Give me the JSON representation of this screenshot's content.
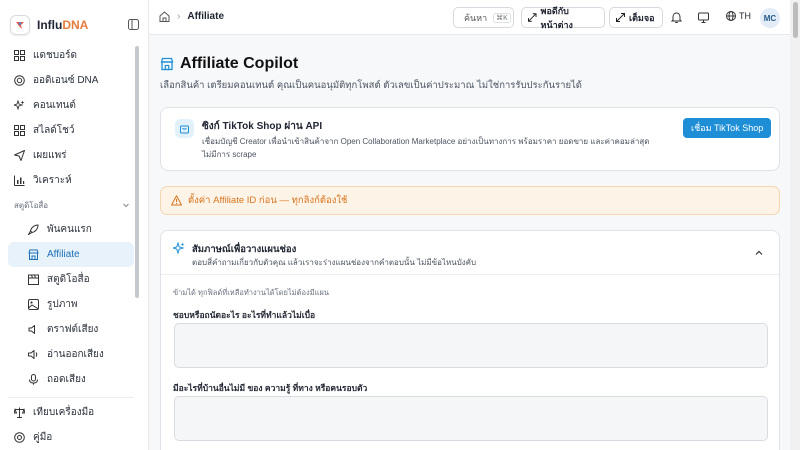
{
  "brand": {
    "prefix": "Influ",
    "suffix": "DNA"
  },
  "sidebar": {
    "items": [
      {
        "label": "แดชบอร์ด",
        "icon": "dashboard-icon"
      },
      {
        "label": "ออดิเอนซ์ DNA",
        "icon": "audience-icon"
      },
      {
        "label": "คอนเทนต์",
        "icon": "sparkle-icon"
      },
      {
        "label": "สไลด์โชว์",
        "icon": "grid-icon"
      },
      {
        "label": "เผยแพร่",
        "icon": "send-icon"
      },
      {
        "label": "วิเคราะห์",
        "icon": "chart-icon"
      }
    ],
    "section_label": "สตูดิโอสื่อ",
    "sub_items": [
      {
        "label": "พันคนแรก",
        "icon": "rocket-icon"
      },
      {
        "label": "Affiliate",
        "icon": "store-icon",
        "active": true
      },
      {
        "label": "สตูดิโอสื่อ",
        "icon": "clapper-icon"
      },
      {
        "label": "รูปภาพ",
        "icon": "image-icon"
      },
      {
        "label": "ตราฟต์เสียง",
        "icon": "speaker-icon"
      },
      {
        "label": "อ่านออกเสียง",
        "icon": "volume-icon"
      },
      {
        "label": "ถอดเสียง",
        "icon": "mic-icon"
      }
    ],
    "bottom_items": [
      {
        "label": "เทียบเครื่องมือ",
        "icon": "scale-icon"
      },
      {
        "label": "คู่มือ",
        "icon": "help-icon"
      }
    ]
  },
  "header": {
    "breadcrumb_current": "Affiliate",
    "search_label": "ค้นหา",
    "search_kbd": "⌘K",
    "popout_label": "พอดีกับหน้าต่าง",
    "fullscreen_label": "เต็มจอ",
    "language": "TH",
    "avatar_initials": "MC"
  },
  "main": {
    "title": "Affiliate Copilot",
    "subtitle": "เลือกสินค้า เตรียมคอนเทนต์ คุณเป็นคนอนุมัติทุกโพสต์ ตัวเลขเป็นค่าประมาณ ไม่ใช่การรับประกันรายได้",
    "tiktok": {
      "title": "ซิงก์ TikTok Shop ผ่าน API",
      "description": "เชื่อมบัญชี Creator เพื่อนำเข้าสินค้าจาก Open Collaboration Marketplace อย่างเป็นทางการ พร้อมราคา ยอดขาย และค่าคอมล่าสุด ไม่มีการ scrape",
      "button": "เชื่อม TikTok Shop"
    },
    "warning": "ตั้งค่า Affiliate ID ก่อน — ทุกลิงก์ต้องใช้",
    "interview": {
      "title": "สัมภาษณ์เพื่อวางแผนช่อง",
      "description": "ตอบสี่คำถามเกี่ยวกับตัวคุณ แล้วเราจะร่างแผนช่องจากคำตอบนั้น ไม่มีข้อไหนบังคับ",
      "note": "ข้ามได้ ทุกฟิลด์ที่เหลือทำงานได้โดยไม่ต้องมีแผน",
      "questions": [
        {
          "label": "ชอบหรือถนัดอะไร อะไรที่ทำแล้วไม่เบื่อ",
          "value": ""
        },
        {
          "label": "มีอะไรที่บ้านอื่นไม่มี ของ ความรู้ ที่ทาง หรือคนรอบตัว",
          "value": ""
        }
      ]
    }
  },
  "colors": {
    "accent": "#1e8fd6",
    "brand_orange": "#e87b3c",
    "warning_text": "#d7751f",
    "warning_bg": "#fdf3e6",
    "active_bg": "#e8f2fb"
  }
}
